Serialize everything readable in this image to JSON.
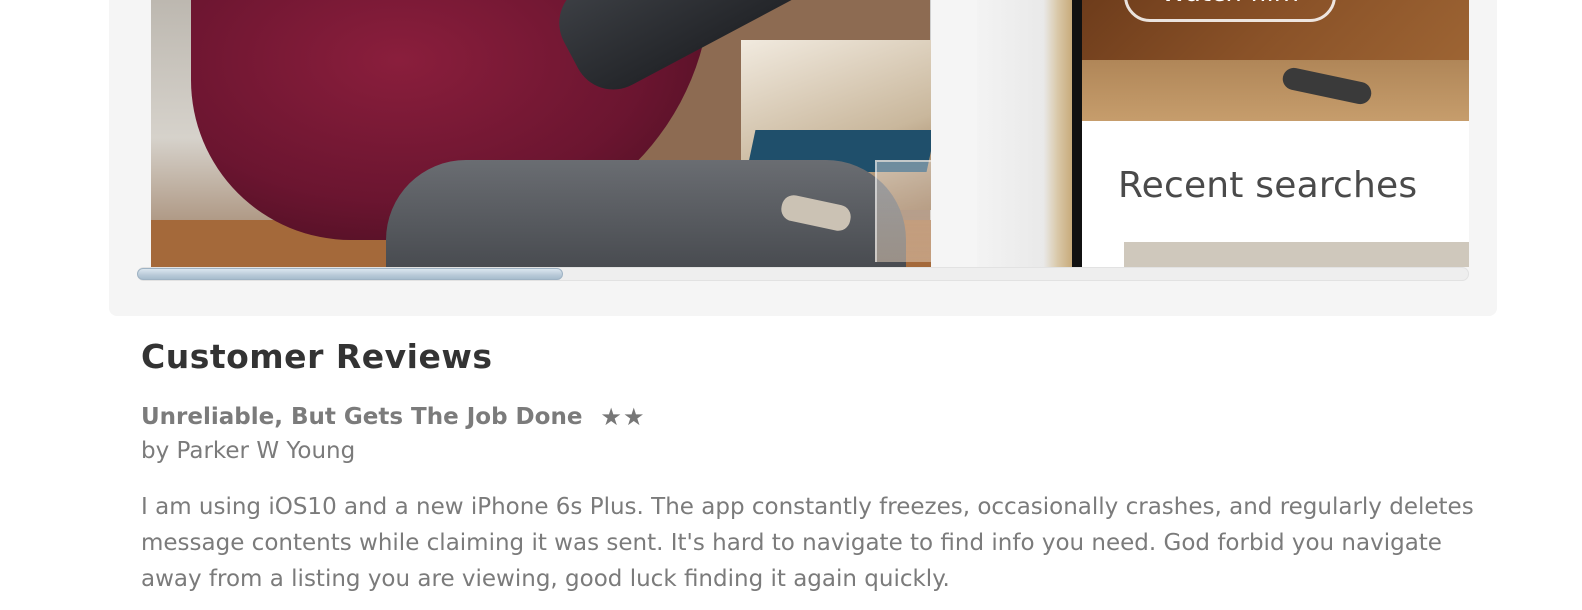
{
  "screenshots": {
    "shot2": {
      "watch_button_label": "Watch film",
      "recent_searches_label": "Recent searches"
    },
    "scroll_position": 0.32
  },
  "reviews": {
    "heading": "Customer Reviews",
    "items": [
      {
        "title": "Unreliable, But Gets The Job Done",
        "stars_text": "★★",
        "rating": 2,
        "author": "by Parker W Young",
        "body": "I am using iOS10 and a new iPhone 6s Plus. The app constantly freezes, occasionally crashes, and regularly deletes message contents while claiming it was sent. It's hard to navigate to find info you need. God forbid you navigate away from a listing you are viewing, good luck finding it again quickly."
      }
    ]
  },
  "colors": {
    "panel_bg": "#f5f5f5",
    "heading_text": "#333333",
    "body_text": "#7b7b7b",
    "scroll_thumb": "#b9cad8"
  }
}
